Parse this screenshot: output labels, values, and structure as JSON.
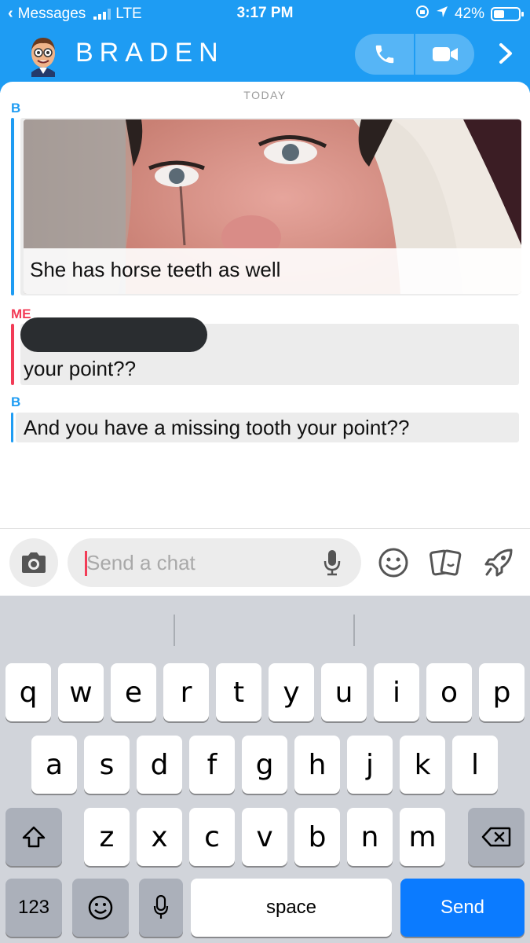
{
  "status_bar": {
    "back_app": "Messages",
    "network": "LTE",
    "time": "3:17 PM",
    "battery": "42%",
    "battery_level": 0.42
  },
  "header": {
    "contact_name": "BRADEN",
    "icons": [
      "bitmoji-avatar",
      "phone-icon",
      "video-icon",
      "chevron-right-icon"
    ]
  },
  "chat": {
    "date_separator": "TODAY",
    "messages": [
      {
        "sender": "B",
        "type": "photo",
        "caption": "She has horse teeth as well"
      },
      {
        "sender": "ME",
        "type": "text",
        "text": "your point??",
        "redacted": true
      },
      {
        "sender": "B",
        "type": "text",
        "text": "And you have a missing tooth your point??"
      }
    ]
  },
  "composer": {
    "placeholder": "Send a chat",
    "icons": [
      "camera-icon",
      "microphone-icon",
      "smiley-icon",
      "stickers-icon",
      "rocket-icon"
    ]
  },
  "keyboard": {
    "row1": [
      "q",
      "w",
      "e",
      "r",
      "t",
      "y",
      "u",
      "i",
      "o",
      "p"
    ],
    "row2": [
      "a",
      "s",
      "d",
      "f",
      "g",
      "h",
      "j",
      "k",
      "l"
    ],
    "row3": [
      "z",
      "x",
      "c",
      "v",
      "b",
      "n",
      "m"
    ],
    "numbers_label": "123",
    "space_label": "space",
    "send_label": "Send"
  },
  "colors": {
    "header_blue": "#1e9cf3",
    "me_red": "#f23c57",
    "send_blue": "#0b7bff"
  }
}
